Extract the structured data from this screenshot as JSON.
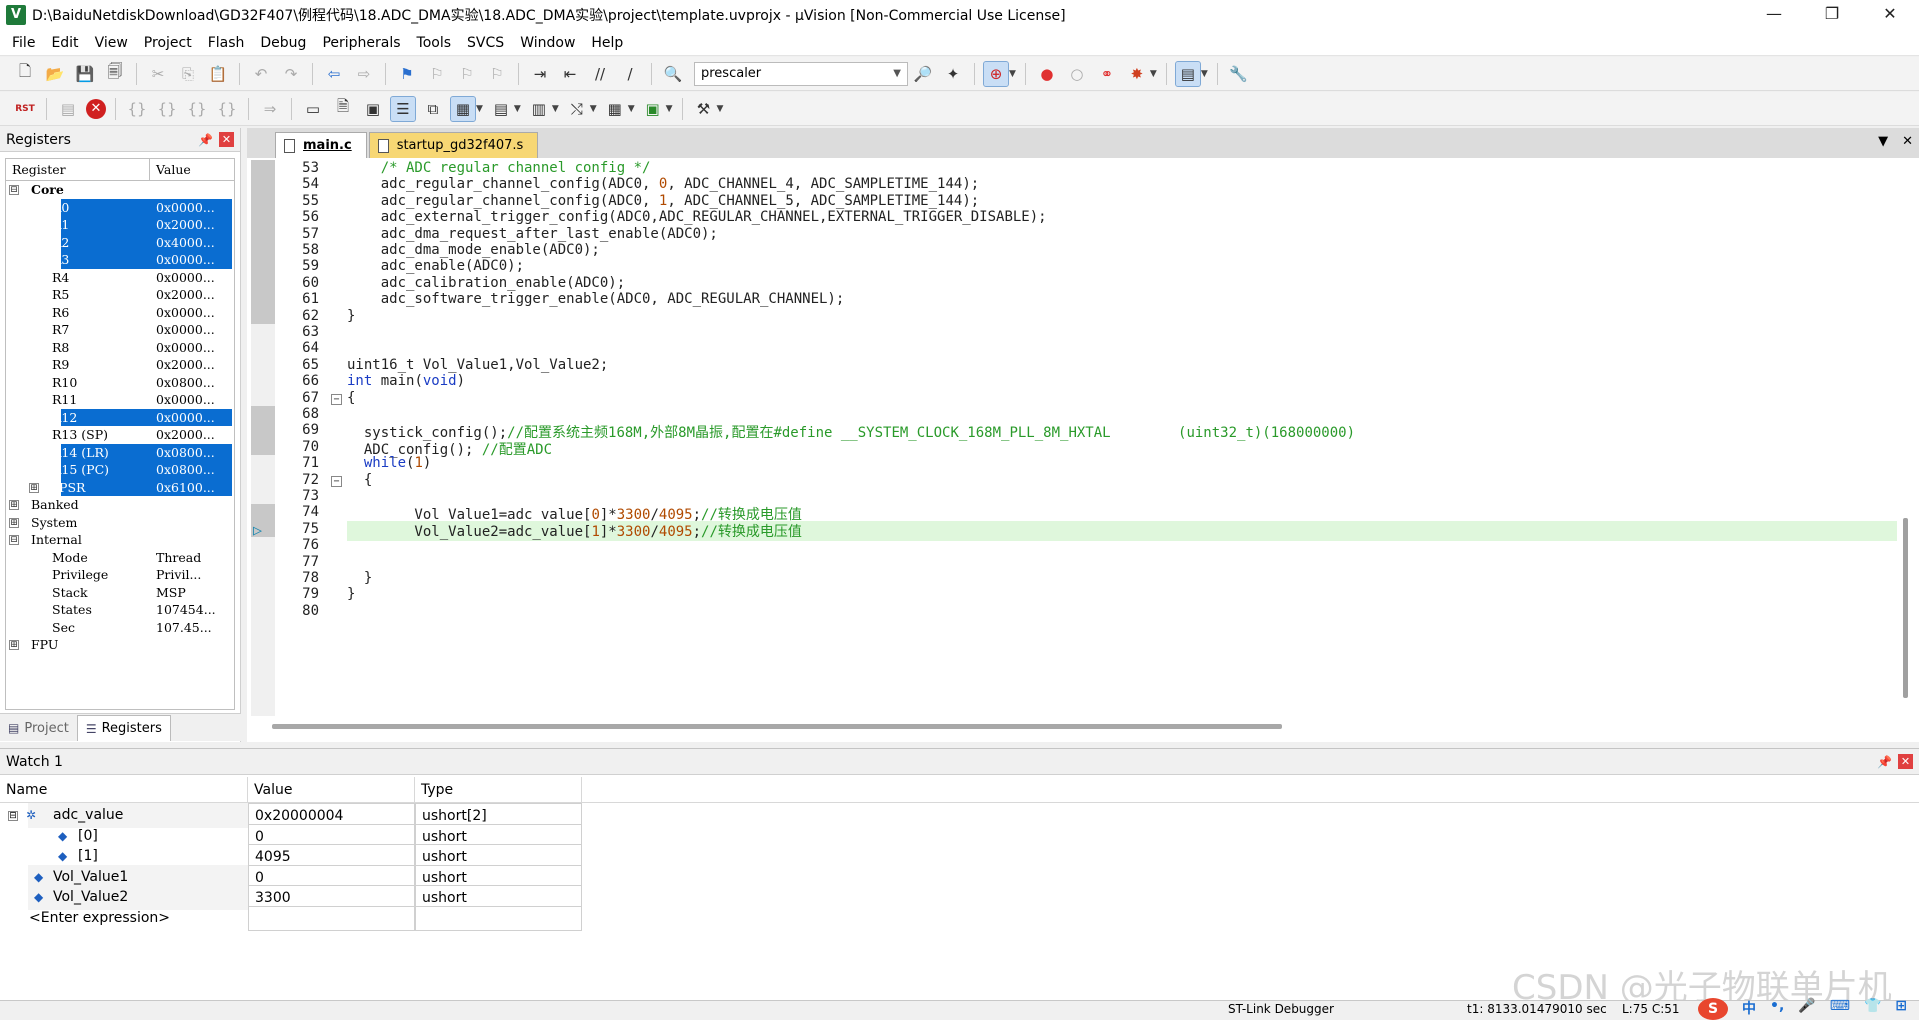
{
  "window": {
    "title": "D:\\BaiduNetdiskDownload\\GD32F407\\例程代码\\18.ADC_DMA实验\\18.ADC_DMA实验\\project\\template.uvprojx - µVision  [Non-Commercial Use License]",
    "app_icon": "V",
    "minimize": "—",
    "maximize": "❐",
    "close": "✕"
  },
  "menu": [
    "File",
    "Edit",
    "View",
    "Project",
    "Flash",
    "Debug",
    "Peripherals",
    "Tools",
    "SVCS",
    "Window",
    "Help"
  ],
  "toolbar": {
    "combo_value": "prescaler",
    "rst_label": "RST"
  },
  "registers": {
    "title": "Registers",
    "col_register": "Register",
    "col_value": "Value",
    "rows": [
      {
        "toggle": "⊟",
        "name": "Core",
        "value": "",
        "indent": 0,
        "sel": false,
        "bold": true
      },
      {
        "toggle": "",
        "name": "R0",
        "value": "0x0000...",
        "indent": 2,
        "sel": true
      },
      {
        "toggle": "",
        "name": "R1",
        "value": "0x2000...",
        "indent": 2,
        "sel": true
      },
      {
        "toggle": "",
        "name": "R2",
        "value": "0x4000...",
        "indent": 2,
        "sel": true
      },
      {
        "toggle": "",
        "name": "R3",
        "value": "0x0000...",
        "indent": 2,
        "sel": true
      },
      {
        "toggle": "",
        "name": "R4",
        "value": "0x0000...",
        "indent": 2,
        "sel": false
      },
      {
        "toggle": "",
        "name": "R5",
        "value": "0x2000...",
        "indent": 2,
        "sel": false
      },
      {
        "toggle": "",
        "name": "R6",
        "value": "0x0000...",
        "indent": 2,
        "sel": false
      },
      {
        "toggle": "",
        "name": "R7",
        "value": "0x0000...",
        "indent": 2,
        "sel": false
      },
      {
        "toggle": "",
        "name": "R8",
        "value": "0x0000...",
        "indent": 2,
        "sel": false
      },
      {
        "toggle": "",
        "name": "R9",
        "value": "0x2000...",
        "indent": 2,
        "sel": false
      },
      {
        "toggle": "",
        "name": "R10",
        "value": "0x0800...",
        "indent": 2,
        "sel": false
      },
      {
        "toggle": "",
        "name": "R11",
        "value": "0x0000...",
        "indent": 2,
        "sel": false
      },
      {
        "toggle": "",
        "name": "R12",
        "value": "0x0000...",
        "indent": 2,
        "sel": true
      },
      {
        "toggle": "",
        "name": "R13 (SP)",
        "value": "0x2000...",
        "indent": 2,
        "sel": false
      },
      {
        "toggle": "",
        "name": "R14 (LR)",
        "value": "0x0800...",
        "indent": 2,
        "sel": true
      },
      {
        "toggle": "",
        "name": "R15 (PC)",
        "value": "0x0800...",
        "indent": 2,
        "sel": true
      },
      {
        "toggle": "⊞",
        "name": "xPSR",
        "value": "0x6100...",
        "indent": 2,
        "sel": true
      },
      {
        "toggle": "⊞",
        "name": "Banked",
        "value": "",
        "indent": 0,
        "sel": false
      },
      {
        "toggle": "⊞",
        "name": "System",
        "value": "",
        "indent": 0,
        "sel": false
      },
      {
        "toggle": "⊟",
        "name": "Internal",
        "value": "",
        "indent": 0,
        "sel": false
      },
      {
        "toggle": "",
        "name": "Mode",
        "value": "Thread",
        "indent": 2,
        "sel": false
      },
      {
        "toggle": "",
        "name": "Privilege",
        "value": "Privil...",
        "indent": 2,
        "sel": false
      },
      {
        "toggle": "",
        "name": "Stack",
        "value": "MSP",
        "indent": 2,
        "sel": false
      },
      {
        "toggle": "",
        "name": "States",
        "value": "107454...",
        "indent": 2,
        "sel": false
      },
      {
        "toggle": "",
        "name": "Sec",
        "value": "107.45...",
        "indent": 2,
        "sel": false
      },
      {
        "toggle": "⊞",
        "name": "FPU",
        "value": "",
        "indent": 0,
        "sel": false
      }
    ],
    "tab_project": "Project",
    "tab_registers": "Registers"
  },
  "editor": {
    "tabs": [
      {
        "label": "main.c",
        "active": true
      },
      {
        "label": "startup_gd32f407.s",
        "active": false
      }
    ],
    "lines": [
      {
        "num": "53",
        "text": "    /* ADC regular channel config */",
        "type": "comment"
      },
      {
        "num": "54",
        "text": "    adc_regular_channel_config(ADC0, 0, ADC_CHANNEL_4, ADC_SAMPLETIME_144);"
      },
      {
        "num": "55",
        "text": "    adc_regular_channel_config(ADC0, 1, ADC_CHANNEL_5, ADC_SAMPLETIME_144);"
      },
      {
        "num": "56",
        "text": "    adc_external_trigger_config(ADC0,ADC_REGULAR_CHANNEL,EXTERNAL_TRIGGER_DISABLE);"
      },
      {
        "num": "57",
        "text": "    adc_dma_request_after_last_enable(ADC0);"
      },
      {
        "num": "58",
        "text": "    adc_dma_mode_enable(ADC0);"
      },
      {
        "num": "59",
        "text": "    adc_enable(ADC0);"
      },
      {
        "num": "60",
        "text": "    adc_calibration_enable(ADC0);"
      },
      {
        "num": "61",
        "text": "    adc_software_trigger_enable(ADC0, ADC_REGULAR_CHANNEL);"
      },
      {
        "num": "62",
        "text": "}"
      },
      {
        "num": "63",
        "text": ""
      },
      {
        "num": "64",
        "text": ""
      },
      {
        "num": "65",
        "text": "uint16_t Vol_Value1,Vol_Value2;"
      },
      {
        "num": "66",
        "text": "int main(void)",
        "type": "main"
      },
      {
        "num": "67",
        "text": "{",
        "fold": true
      },
      {
        "num": "68",
        "text": ""
      },
      {
        "num": "69",
        "text": "  systick_config();//配置系统主频168M,外部8M晶振,配置在#define __SYSTEM_CLOCK_168M_PLL_8M_HXTAL        (uint32_t)(168000000)",
        "type": "systick"
      },
      {
        "num": "70",
        "text": "  ADC_config(); //配置ADC",
        "type": "adccfg"
      },
      {
        "num": "71",
        "text": "  while(1)",
        "type": "while"
      },
      {
        "num": "72",
        "text": "  {",
        "fold": true
      },
      {
        "num": "73",
        "text": ""
      },
      {
        "num": "74",
        "text": "        Vol_Value1=adc_value[0]*3300/4095;//转换成电压值",
        "type": "vol"
      },
      {
        "num": "75",
        "text": "        Vol_Value2=adc_value[1]*3300/4095;//转换成电压值",
        "type": "vol",
        "highlight": true
      },
      {
        "num": "76",
        "text": ""
      },
      {
        "num": "77",
        "text": ""
      },
      {
        "num": "78",
        "text": "  }"
      },
      {
        "num": "79",
        "text": "}"
      },
      {
        "num": "80",
        "text": ""
      }
    ]
  },
  "watch": {
    "title": "Watch 1",
    "col_name": "Name",
    "col_value": "Value",
    "col_type": "Type",
    "rows": [
      {
        "name": "adc_value",
        "value": "0x20000004 adc_value",
        "type": "ushort[2]",
        "level": 0,
        "toggle": "⊟",
        "icon": "struct"
      },
      {
        "name": "[0]",
        "value": "0",
        "type": "ushort",
        "level": 1,
        "toggle": "",
        "icon": "var"
      },
      {
        "name": "[1]",
        "value": "4095",
        "type": "ushort",
        "level": 1,
        "toggle": "",
        "icon": "var"
      },
      {
        "name": "Vol_Value1",
        "value": "0",
        "type": "ushort",
        "level": 0,
        "toggle": "",
        "icon": "var"
      },
      {
        "name": "Vol_Value2",
        "value": "3300",
        "type": "ushort",
        "level": 0,
        "toggle": "",
        "icon": "var"
      },
      {
        "name": "<Enter expression>",
        "value": "",
        "type": "",
        "level": 0,
        "toggle": "",
        "icon": "none"
      }
    ]
  },
  "watermark": "CSDN @光子物联单片机",
  "status": {
    "debugger": "ST-Link Debugger",
    "time": "t1: 8133.01479010 sec",
    "position": "L:75 C:51",
    "ime": [
      "S",
      "中",
      "•,",
      "🎤",
      "⌨",
      "👕",
      "⊞"
    ]
  }
}
